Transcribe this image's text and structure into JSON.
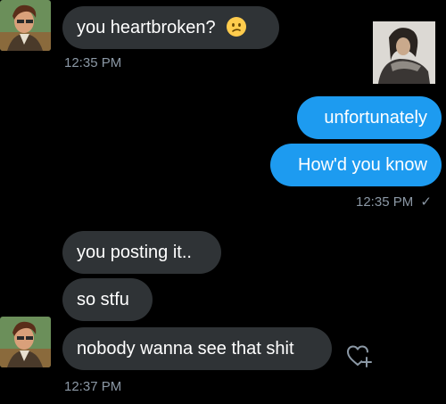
{
  "conversation": {
    "messages": [
      {
        "sender": "them",
        "text": "you heartbroken?",
        "emoji": "confused-face-emoji"
      },
      {
        "sender": "me",
        "text": "unfortunately"
      },
      {
        "sender": "me",
        "text": "How'd you know"
      },
      {
        "sender": "them",
        "text": "you posting it.."
      },
      {
        "sender": "them",
        "text": "so stfu"
      },
      {
        "sender": "them",
        "text": "nobody wanna see that shit"
      }
    ],
    "timestamps": {
      "first": "12:35 PM",
      "second": "12:35 PM",
      "third": "12:37 PM"
    },
    "read_receipt": "✓"
  },
  "icons": {
    "avatar": "user-avatar",
    "shared_image": "shared-photo",
    "reaction": "add-reaction-heart-icon"
  },
  "colors": {
    "background": "#000000",
    "incoming_bubble": "#2f3336",
    "outgoing_bubble": "#1d9bf0",
    "timestamp": "#8b98a5"
  }
}
